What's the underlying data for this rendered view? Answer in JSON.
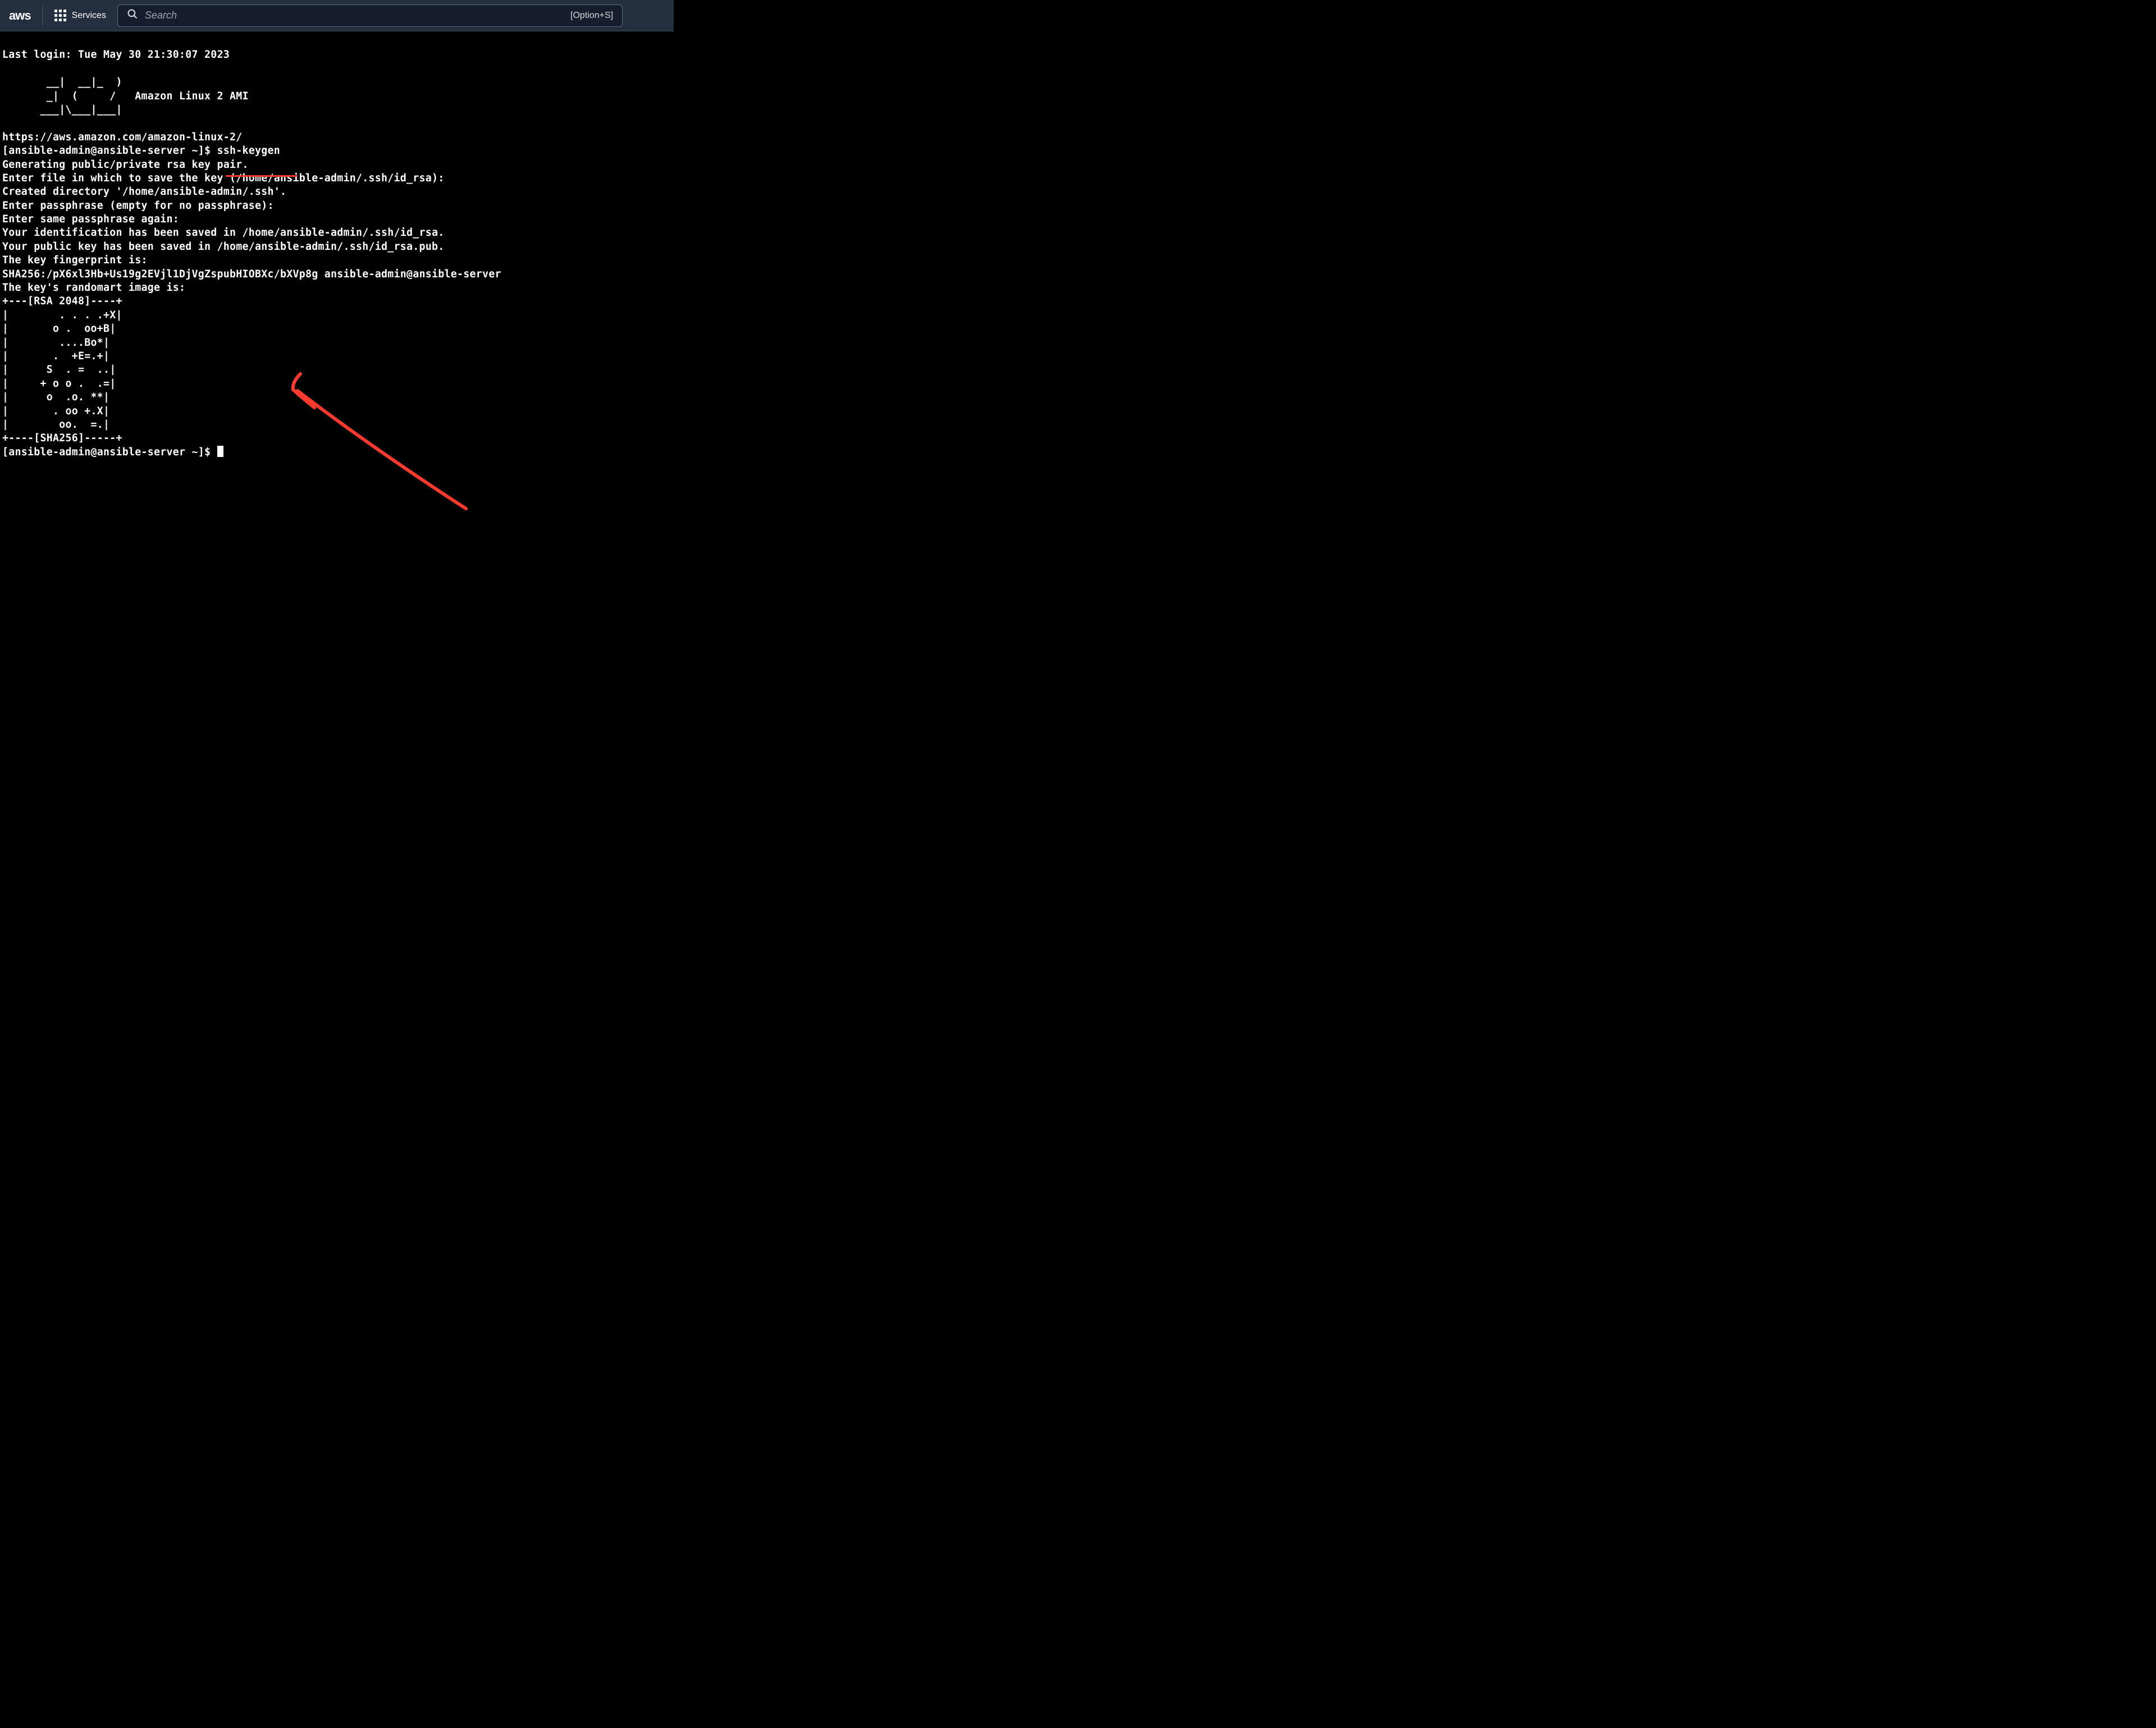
{
  "header": {
    "logo_text": "aws",
    "services_label": "Services",
    "search_placeholder": "Search",
    "search_shortcut": "[Option+S]"
  },
  "terminal": {
    "last_login": "Last login: Tue May 30 21:30:07 2023",
    "ascii_art_1": "       __|  __|_  )",
    "ascii_art_2": "       _|  (     /   Amazon Linux 2 AMI",
    "ascii_art_3": "      ___|\\___|___|",
    "url": "https://aws.amazon.com/amazon-linux-2/",
    "prompt1_prefix": "[ansible-admin@ansible-server ~]$ ",
    "cmd1": "ssh-keygen",
    "out1": "Generating public/private rsa key pair.",
    "out2": "Enter file in which to save the key (/home/ansible-admin/.ssh/id_rsa):",
    "out3": "Created directory '/home/ansible-admin/.ssh'.",
    "out4": "Enter passphrase (empty for no passphrase):",
    "out5": "Enter same passphrase again:",
    "out6": "Your identification has been saved in /home/ansible-admin/.ssh/id_rsa.",
    "out7": "Your public key has been saved in /home/ansible-admin/.ssh/id_rsa.pub.",
    "out8": "The key fingerprint is:",
    "out9": "SHA256:/pX6xl3Hb+Us19g2EVjl1DjVgZspubHIOBXc/bXVp8g ansible-admin@ansible-server",
    "out10": "The key's randomart image is:",
    "ra1": "+---[RSA 2048]----+",
    "ra2": "|        . . . .+X|",
    "ra3": "|       o .  oo+B|",
    "ra4": "|        ....Bo*|",
    "ra5": "|       .  +E=.+|",
    "ra6": "|      S  . =  ..|",
    "ra7": "|     + o o .  .=|",
    "ra8": "|      o  .o. **|",
    "ra9": "|       . oo +.X|",
    "ra10": "|        oo.  =.|",
    "ra11": "+----[SHA256]-----+",
    "prompt2_prefix": "[ansible-admin@ansible-server ~]$ "
  },
  "annotations": {
    "underline_color": "#ff3b30",
    "arrow_color": "#ff3b30"
  }
}
